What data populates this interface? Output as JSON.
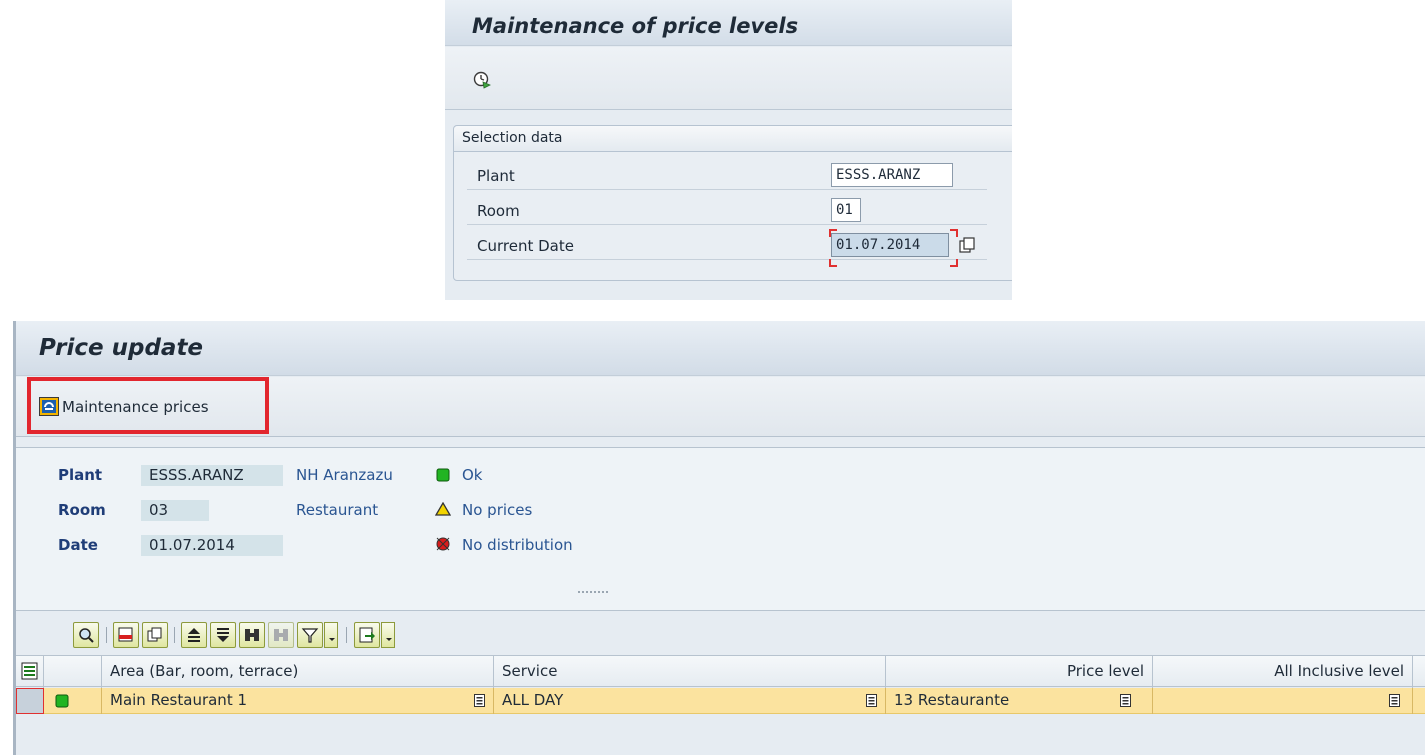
{
  "top_window": {
    "title": "Maintenance of price levels",
    "toolbar": {
      "execute_icon": "execute-clock-icon"
    },
    "selection": {
      "group_title": "Selection data",
      "fields": [
        {
          "label": "Plant",
          "value": "ESSS.ARANZ"
        },
        {
          "label": "Room",
          "value": "01"
        },
        {
          "label": "Current Date",
          "value": "01.07.2014"
        }
      ]
    }
  },
  "bottom_window": {
    "title": "Price update",
    "toolbar": {
      "maintenance_button_label": "Maintenance prices"
    },
    "info": {
      "plant_label": "Plant",
      "plant_value": "ESSS.ARANZ",
      "plant_name": "NH Aranzazu",
      "room_label": "Room",
      "room_value": "03",
      "room_name": "Restaurant",
      "date_label": "Date",
      "date_value": "01.07.2014"
    },
    "legend": [
      {
        "icon": "green-square-icon",
        "text": "Ok",
        "color": "#22b422"
      },
      {
        "icon": "yellow-triangle-icon",
        "text": "No prices",
        "color": "#f2d400"
      },
      {
        "icon": "red-circle-icon",
        "text": "No distribution",
        "color": "#d81c1c"
      }
    ],
    "grid": {
      "columns": [
        "Area (Bar, room, terrace)",
        "Service",
        "Price level",
        "All Inclusive level"
      ],
      "rows": [
        {
          "status": "green",
          "area": "Main Restaurant 1",
          "service": "ALL DAY",
          "price_level": "13 Restaurante",
          "all_inclusive_level": ""
        }
      ]
    }
  },
  "colors": {
    "highlight_border": "#e2262e",
    "row_selected": "#fbe39f",
    "label_blue": "#1f3d78"
  }
}
